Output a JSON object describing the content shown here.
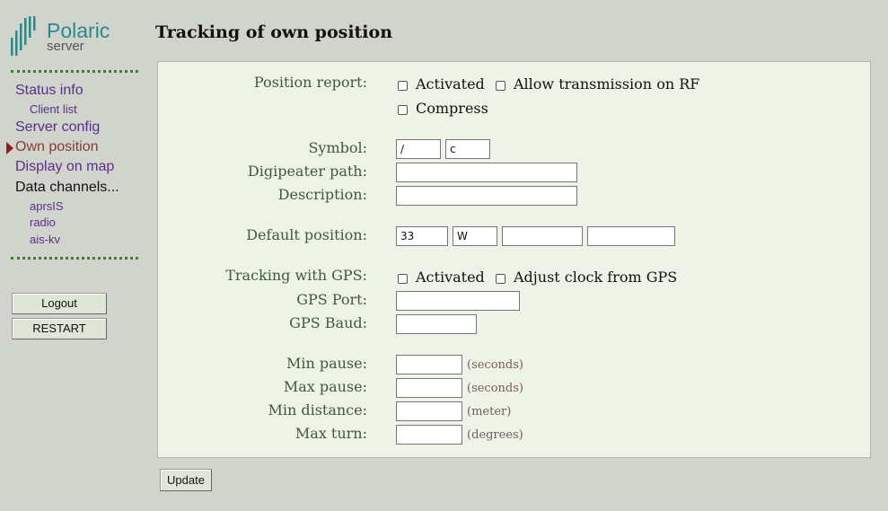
{
  "logo": {
    "name": "Polaric",
    "sub": "server"
  },
  "nav": {
    "status_info": "Status info",
    "client_list": "Client list",
    "server_config": "Server config",
    "own_position": "Own position",
    "display_on_map": "Display on map",
    "data_channels": "Data channels...",
    "channels": [
      "aprsIS",
      "radio",
      "ais-kv"
    ]
  },
  "buttons": {
    "logout": "Logout",
    "restart": "RESTART",
    "update": "Update"
  },
  "page_title": "Tracking of own position",
  "form": {
    "position_report": {
      "label": "Position report:",
      "activated": "Activated",
      "allow_rf": "Allow transmission on RF",
      "compress": "Compress"
    },
    "symbol": {
      "label": "Symbol:",
      "table": "/",
      "symbol": "c"
    },
    "digipeater_path": {
      "label": "Digipeater path:",
      "value": ""
    },
    "description": {
      "label": "Description:",
      "value": ""
    },
    "default_position": {
      "label": "Default position:",
      "zone": "33",
      "band": "W",
      "easting": "",
      "northing": ""
    },
    "tracking_gps": {
      "label": "Tracking with GPS:",
      "activated": "Activated",
      "adjust_clock": "Adjust clock from GPS"
    },
    "gps_port": {
      "label": "GPS Port:",
      "value": ""
    },
    "gps_baud": {
      "label": "GPS Baud:",
      "value": ""
    },
    "min_pause": {
      "label": "Min pause:",
      "value": "",
      "unit": "(seconds)"
    },
    "max_pause": {
      "label": "Max pause:",
      "value": "",
      "unit": "(seconds)"
    },
    "min_distance": {
      "label": "Min distance:",
      "value": "",
      "unit": "(meter)"
    },
    "max_turn": {
      "label": "Max turn:",
      "value": "",
      "unit": "(degrees)"
    }
  },
  "colors": {
    "background": "#d0d4cc",
    "panel": "#eef3e8",
    "label": "#3e5a3a",
    "link": "#5a2f8a",
    "current": "#8a3a3a"
  }
}
